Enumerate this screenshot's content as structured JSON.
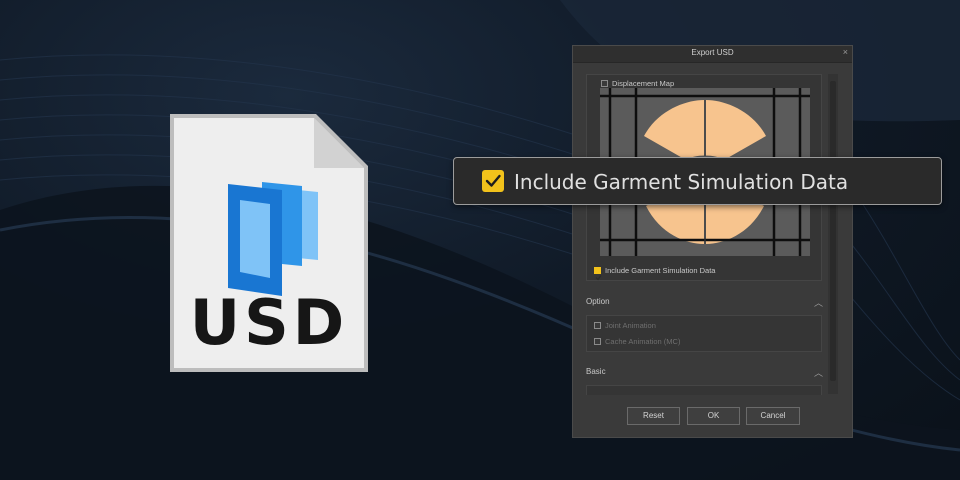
{
  "file_icon": {
    "label": "USD",
    "colors": {
      "paper": "#eeeeee",
      "fold": "#d8d8d8",
      "layer_dark": "#1976d2",
      "layer_mid": "#2f95e8",
      "layer_light": "#7fc3f7"
    }
  },
  "dialog": {
    "title": "Export USD",
    "close_label": "×",
    "displacement_map": {
      "label": "Displacement Map",
      "checked": false
    },
    "include_garment": {
      "label": "Include Garment Simulation Data",
      "checked": true
    },
    "option_section": {
      "title": "Option",
      "items": [
        {
          "label": "Joint Animation",
          "checked": false
        },
        {
          "label": "Cache Animation (MC)",
          "checked": false
        }
      ]
    },
    "basic_section": {
      "title": "Basic"
    },
    "buttons": {
      "reset": "Reset",
      "ok": "OK",
      "cancel": "Cancel"
    }
  },
  "callout": {
    "label": "Include Garment Simulation Data",
    "checked": true
  },
  "colors": {
    "accent": "#f2c21b",
    "pattern_fill": "#f7c48e",
    "dialog_bg": "#3a3a3a"
  },
  "icons": [
    "close-icon",
    "chevron-up-icon",
    "checkmark-icon",
    "usd-file-icon"
  ]
}
